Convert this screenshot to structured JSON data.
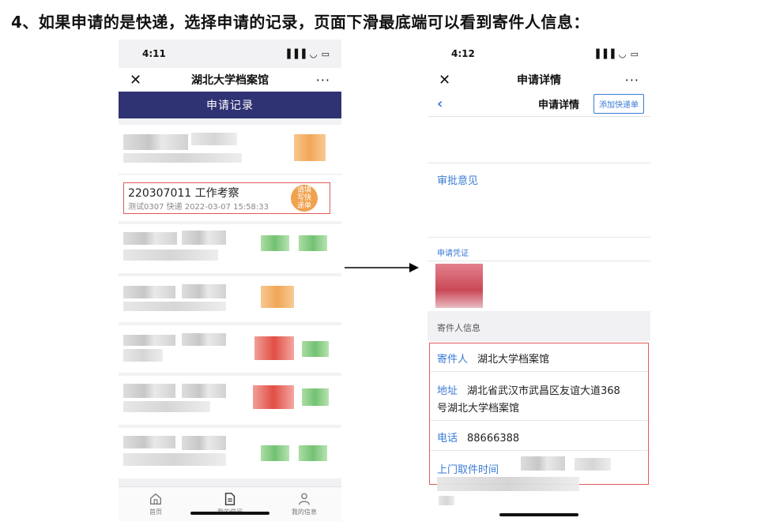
{
  "heading": "4、如果申请的是快递，选择申请的记录，页面下滑最底端可以看到寄件人信息：",
  "left_phone": {
    "status_time": "4:11",
    "status_icons": "▐▐▐ ◡ ▭",
    "nav_title": "湖北大学档案馆",
    "close_glyph": "✕",
    "more_glyph": "···",
    "banner_title": "申请记录",
    "record": {
      "title": "220307011 工作考察",
      "subtitle": "测试0307  快递  2022-03-07 15:58:33",
      "badge": "请填写快递单"
    },
    "tabs": [
      {
        "label": "首页",
        "icon": "home-icon"
      },
      {
        "label": "我的借阅",
        "icon": "document-icon"
      },
      {
        "label": "我的信息",
        "icon": "user-icon"
      }
    ]
  },
  "right_phone": {
    "status_time": "4:12",
    "status_icons": "▐▐▐ ◡ ▭",
    "nav_title": "申请详情",
    "close_glyph": "✕",
    "more_glyph": "···",
    "back_glyph": "‹",
    "subnav_title": "申请详情",
    "add_button": "添加快递单",
    "approval_label": "审批意见",
    "voucher_label": "申请凭证",
    "sender_section": "寄件人信息",
    "sender": {
      "name_key": "寄件人",
      "name_val": "湖北大学档案馆",
      "address_key": "地址",
      "address_val_1": "湖北省武汉市武昌区友谊大道368",
      "address_val_2": "号湖北大学档案馆",
      "phone_key": "电话",
      "phone_val": "88666388",
      "pickup_key": "上门取件时间"
    }
  },
  "colors": {
    "banner": "#2f3273",
    "accent_blue": "#3a7bd5",
    "highlight_red": "#e05a5a",
    "badge_orange": "#f0a24e"
  }
}
